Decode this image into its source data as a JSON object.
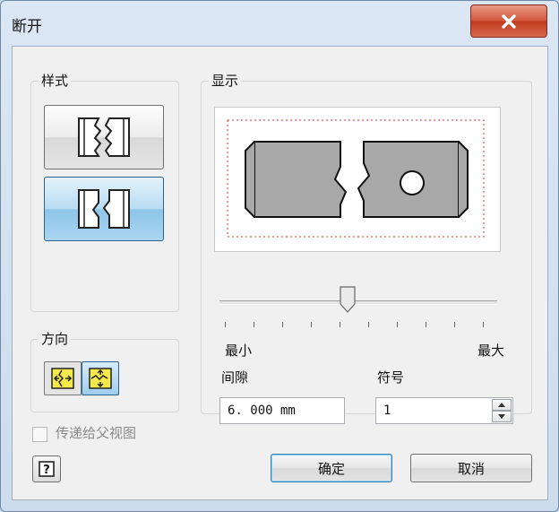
{
  "window": {
    "title": "断开",
    "close_glyph": "X"
  },
  "style_group": {
    "label": "样式",
    "selected_index": 1
  },
  "display_group": {
    "label": "显示",
    "slider_min_label": "最小",
    "slider_max_label": "最大"
  },
  "gap": {
    "label": "间隙",
    "value": "6. 000 mm"
  },
  "symbol": {
    "label": "符号",
    "value": "1"
  },
  "direction_group": {
    "label": "方向",
    "selected_index": 1
  },
  "pass_to_parent": {
    "label": "传递给父视图",
    "checked": false,
    "enabled": false
  },
  "buttons": {
    "ok": "确定",
    "cancel": "取消",
    "help": "?"
  },
  "colors": {
    "accent_yellow": "#f5e84a",
    "selection_blue": "#3c7fb1",
    "close_red": "#c7432a"
  }
}
